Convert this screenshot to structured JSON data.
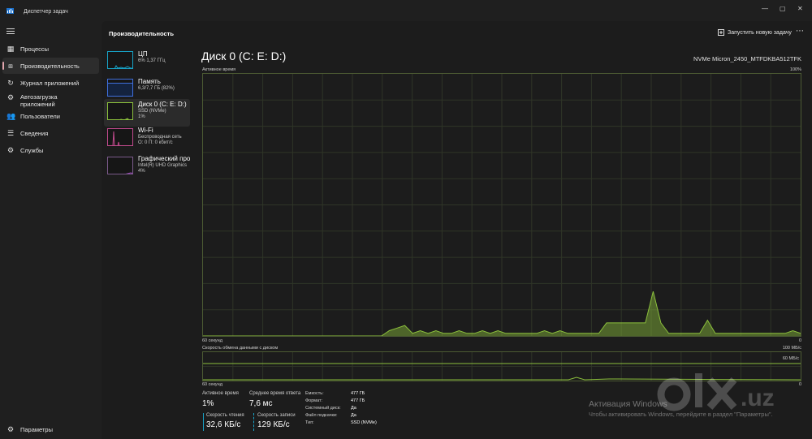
{
  "window": {
    "title": "Диспетчер задач",
    "controls": [
      "—",
      "▢",
      "✕"
    ]
  },
  "nav": {
    "items": [
      {
        "label": "Процессы",
        "icon": "processes-icon"
      },
      {
        "label": "Производительность",
        "icon": "performance-icon"
      },
      {
        "label": "Журнал приложений",
        "icon": "app-history-icon"
      },
      {
        "label": "Автозагрузка приложений",
        "icon": "startup-icon"
      },
      {
        "label": "Пользователи",
        "icon": "users-icon"
      },
      {
        "label": "Сведения",
        "icon": "details-icon"
      },
      {
        "label": "Службы",
        "icon": "services-icon"
      }
    ],
    "settings": "Параметры",
    "accent_color": "#e1a5ad"
  },
  "header": {
    "title": "Производительность",
    "run_task": "Запустить новую задачу",
    "more": "⋯"
  },
  "resources": [
    {
      "name": "ЦП",
      "sub1": "6% 1,37 ГГц",
      "sub2": "",
      "sub3": "",
      "color": "#17a2c6"
    },
    {
      "name": "Память",
      "sub1": "6,3/7,7 ГБ (82%)",
      "sub2": "",
      "sub3": "",
      "color": "#3f6fdc"
    },
    {
      "name": "Диск 0 (C: E: D:)",
      "sub1": "SSD (NVMe)",
      "sub2": "1%",
      "sub3": "",
      "color": "#8bbf3c"
    },
    {
      "name": "Wi-Fi",
      "sub1": "Беспроводная сеть",
      "sub2": "О: 0 П: 0 кбит/с",
      "sub3": "",
      "color": "#c04a8c"
    },
    {
      "name": "Графический про",
      "sub1": "Intel(R) UHD Graphics",
      "sub2": "4%",
      "sub3": "",
      "color": "#a44fc4"
    }
  ],
  "detail": {
    "title": "Диск 0 (C: E: D:)",
    "model": "NVMe Micron_2450_MTFDKBA512TFK",
    "active_time_label": "Активное время",
    "active_time_max": "100%",
    "x_left": "60 секунд",
    "x_right": "0",
    "transfer_label": "Скорость обмена данными с диском",
    "transfer_max": "100 МБ/с",
    "transfer_mid": "60 МБ/с",
    "x_left2": "60 секунд",
    "x_right2": "0",
    "line_color": "#8bbf3c"
  },
  "stats": {
    "active_time_label": "Активное время",
    "active_time_value": "1%",
    "avg_response_label": "Среднее время ответа",
    "avg_response_value": "7,6 мс",
    "read_label": "Скорость чтения",
    "read_value": "32,6 КБ/с",
    "write_label": "Скорость записи",
    "write_value": "129 КБ/с"
  },
  "props": [
    {
      "k": "Емкость:",
      "v": "477 ГБ"
    },
    {
      "k": "Формат:",
      "v": "477 ГБ"
    },
    {
      "k": "Системный диск:",
      "v": "Да"
    },
    {
      "k": "Файл подкачки:",
      "v": "Да"
    },
    {
      "k": "Тип:",
      "v": "SSD (NVMe)"
    }
  ],
  "watermark": {
    "line1": "Активация Windows",
    "line2": "Чтобы активировать Windows, перейдите в раздел \"Параметры\".",
    "olx_domain": ".uz"
  },
  "chart_data": {
    "type": "area",
    "title": "Активное время",
    "x_range_seconds": [
      60,
      0
    ],
    "ylim": [
      0,
      100
    ],
    "x": [
      60,
      59,
      58,
      57,
      56,
      55,
      54,
      53,
      52,
      51,
      50,
      49,
      48,
      47,
      46,
      45,
      44,
      43,
      42,
      41,
      40,
      39,
      38,
      37,
      36,
      35,
      34,
      33,
      32,
      31,
      30,
      29,
      28,
      27,
      26,
      25,
      24,
      23,
      22,
      21,
      20,
      19,
      18,
      17,
      16,
      15,
      14,
      13,
      12,
      11,
      10,
      9,
      8,
      7,
      6,
      5,
      4,
      3,
      2,
      1,
      0
    ],
    "values": [
      0,
      0,
      0,
      0,
      0,
      0,
      0,
      0,
      0,
      0,
      0,
      0,
      0,
      0,
      0,
      0,
      0,
      0,
      0,
      0,
      0,
      0,
      0,
      0,
      2,
      3,
      4,
      1,
      2,
      1,
      2,
      1,
      1,
      2,
      1,
      1,
      2,
      1,
      2,
      1,
      1,
      1,
      1,
      1,
      2,
      1,
      2,
      1,
      1,
      1,
      1,
      1,
      5,
      5,
      5,
      5,
      5,
      5,
      17,
      5,
      1,
      1,
      1,
      1,
      1,
      6,
      1,
      1,
      1,
      1,
      1,
      1,
      1,
      1,
      1,
      1,
      2,
      1
    ]
  }
}
